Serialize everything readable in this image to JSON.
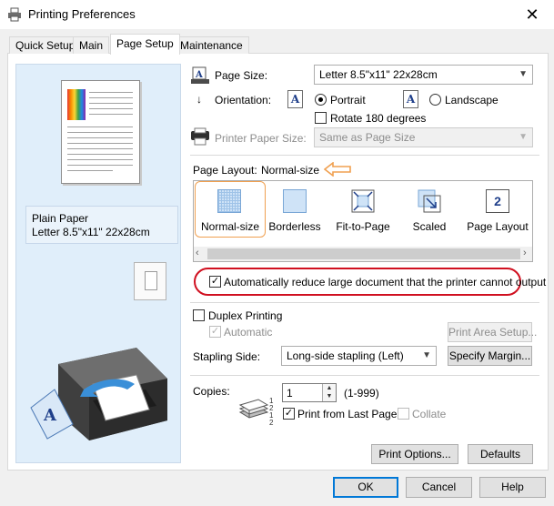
{
  "window": {
    "title": "Printing Preferences",
    "close_glyph": "✕"
  },
  "tabs": [
    {
      "label": "Quick Setup"
    },
    {
      "label": "Main"
    },
    {
      "label": "Page Setup",
      "active": true
    },
    {
      "label": "Maintenance"
    }
  ],
  "preview": {
    "media_type": "Plain Paper",
    "paper_size": "Letter 8.5\"x11\" 22x28cm"
  },
  "page_size": {
    "label": "Page Size:",
    "value": "Letter 8.5\"x11\" 22x28cm"
  },
  "orientation": {
    "label": "Orientation:",
    "icon_letter": "A",
    "portrait_label": "Portrait",
    "landscape_label": "Landscape",
    "selected": "Portrait",
    "rotate_label": "Rotate 180 degrees",
    "rotate_checked": false
  },
  "printer_paper_size": {
    "label": "Printer Paper Size:",
    "value": "Same as Page Size"
  },
  "page_layout": {
    "label": "Page Layout:",
    "value": "Normal-size",
    "options": [
      {
        "label": "Normal-size"
      },
      {
        "label": "Borderless"
      },
      {
        "label": "Fit-to-Page"
      },
      {
        "label": "Scaled"
      },
      {
        "label": "Page Layout",
        "badge": "2"
      }
    ]
  },
  "auto_reduce": {
    "label": "Automatically reduce large document that the printer cannot output",
    "checked": true
  },
  "duplex": {
    "label": "Duplex Printing",
    "checked": false,
    "automatic_label": "Automatic",
    "automatic_checked": true,
    "print_area_label": "Print Area Setup..."
  },
  "stapling": {
    "label": "Stapling Side:",
    "value": "Long-side stapling (Left)",
    "margin_button": "Specify Margin..."
  },
  "copies": {
    "label": "Copies:",
    "value": "1",
    "range": "(1-999)",
    "print_from_last_label": "Print from Last Page",
    "print_from_last_checked": true,
    "collate_label": "Collate",
    "collate_checked": false
  },
  "panel_buttons": {
    "print_options": "Print Options...",
    "defaults": "Defaults"
  },
  "dialog_buttons": {
    "ok": "OK",
    "cancel": "Cancel",
    "help": "Help"
  },
  "colors": {
    "accent": "#0078d7",
    "highlight_orange": "#f0a050",
    "highlight_red": "#d01020",
    "preview_bg": "#e0eefa"
  },
  "icons": {
    "title": "printer-icon",
    "page_size": "page-size-icon",
    "orientation": "orientation-arrow-icon",
    "printer_paper": "printer-paper-icon",
    "copies": "copies-stack-icon"
  }
}
